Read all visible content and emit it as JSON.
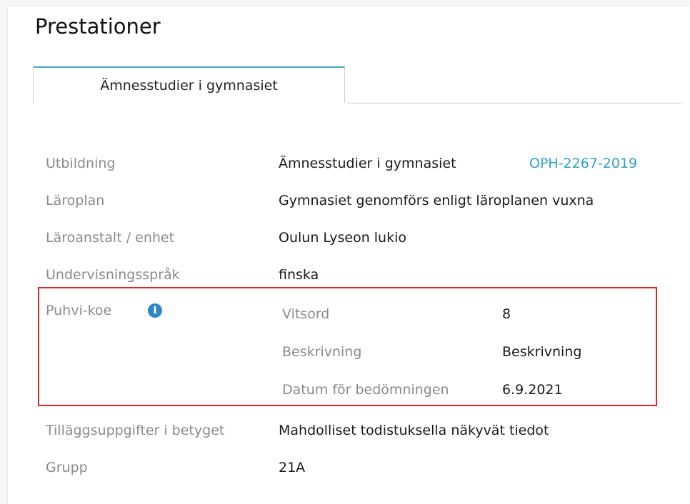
{
  "page": {
    "title": "Prestationer"
  },
  "tabs": [
    {
      "label": "Ämnesstudier i gymnasiet"
    }
  ],
  "details": {
    "utbildning": {
      "label": "Utbildning",
      "value": "Ämnesstudier i gymnasiet",
      "link": "OPH-2267-2019"
    },
    "laroplan": {
      "label": "Läroplan",
      "value": "Gymnasiet genomförs enligt läroplanen vuxna"
    },
    "laroanstalt": {
      "label": "Läroanstalt / enhet",
      "value": "Oulun Lyseon lukio"
    },
    "undervisningssprak": {
      "label": "Undervisningsspråk",
      "value": "finska"
    },
    "puhvi": {
      "label": "Puhvi-koe",
      "info_icon": "info-circle-icon",
      "vitsord": {
        "label": "Vitsord",
        "value": "8"
      },
      "beskrivning": {
        "label": "Beskrivning",
        "value": "Beskrivning"
      },
      "datum": {
        "label": "Datum för bedömningen",
        "value": "6.9.2021"
      }
    },
    "tillagg": {
      "label": "Tilläggsuppgifter i betyget",
      "value": "Mahdolliset todistuksella näkyvät tiedot"
    },
    "grupp": {
      "label": "Grupp",
      "value": "21A"
    }
  },
  "colors": {
    "accent": "#2f9fc9",
    "tab_top": "#43a5c9",
    "highlight_border": "#d9262c",
    "info_icon": "#2f86c5"
  }
}
